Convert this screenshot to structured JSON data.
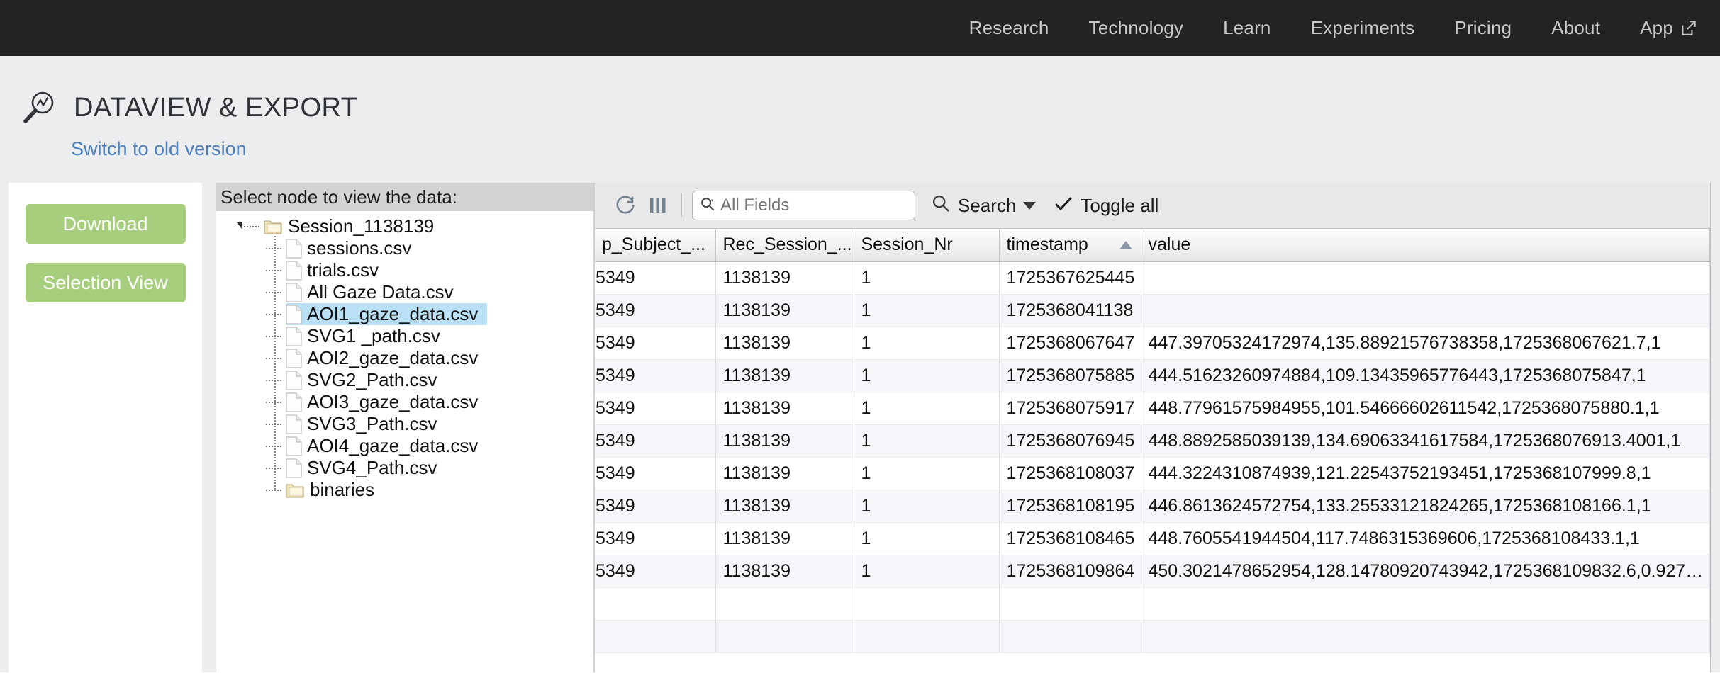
{
  "topnav": {
    "items": [
      {
        "label": "Research",
        "icon": null
      },
      {
        "label": "Technology",
        "icon": null
      },
      {
        "label": "Learn",
        "icon": null
      },
      {
        "label": "Experiments",
        "icon": null
      },
      {
        "label": "Pricing",
        "icon": null
      },
      {
        "label": "About",
        "icon": null
      },
      {
        "label": "App",
        "icon": "external-link-icon"
      }
    ],
    "background_color": "#232323",
    "text_color": "#c9c9c9"
  },
  "header": {
    "title": "DATAVIEW & EXPORT",
    "logo_icon": "magnifier-chart-icon",
    "switch_link": "Switch to old version",
    "link_color": "#4a7fbf",
    "band_color": "#ebedee"
  },
  "actions": {
    "download_label": "Download",
    "selection_view_label": "Selection View",
    "button_color": "#a6ce7c"
  },
  "tree": {
    "header": "Select node to view the data:",
    "root": {
      "label": "Session_1138139",
      "icon": "folder-icon"
    },
    "children": [
      {
        "label": "sessions.csv",
        "icon": "file-icon",
        "selected": false
      },
      {
        "label": "trials.csv",
        "icon": "file-icon",
        "selected": false
      },
      {
        "label": "All Gaze Data.csv",
        "icon": "file-icon",
        "selected": false
      },
      {
        "label": "AOI1_gaze_data.csv",
        "icon": "file-icon",
        "selected": true
      },
      {
        "label": "SVG1 _path.csv",
        "icon": "file-icon",
        "selected": false
      },
      {
        "label": "AOI2_gaze_data.csv",
        "icon": "file-icon",
        "selected": false
      },
      {
        "label": "SVG2_Path.csv",
        "icon": "file-icon",
        "selected": false
      },
      {
        "label": "AOI3_gaze_data.csv",
        "icon": "file-icon",
        "selected": false
      },
      {
        "label": "SVG3_Path.csv",
        "icon": "file-icon",
        "selected": false
      },
      {
        "label": "AOI4_gaze_data.csv",
        "icon": "file-icon",
        "selected": false
      },
      {
        "label": "SVG4_Path.csv",
        "icon": "file-icon",
        "selected": false
      },
      {
        "label": "binaries",
        "icon": "folder-icon",
        "selected": false
      }
    ],
    "selection_color": "#b9e0f5"
  },
  "toolbar": {
    "refresh_icon": "refresh-icon",
    "columns_icon": "columns-icon",
    "search_placeholder": "All Fields",
    "search_value": "",
    "search_field_icon": "search-field-icon",
    "search_label": "Search",
    "search_dropdown_icon": "chevron-down-icon",
    "toggle_all_label": "Toggle all",
    "toggle_all_icon": "check-icon"
  },
  "grid": {
    "columns": [
      {
        "label": "p_Subject_...",
        "sorted": false
      },
      {
        "label": "Rec_Session_...",
        "sorted": false
      },
      {
        "label": "Session_Nr",
        "sorted": false
      },
      {
        "label": "timestamp",
        "sorted": true,
        "sort_dir": "asc"
      },
      {
        "label": "value",
        "sorted": false
      }
    ],
    "rows": [
      {
        "subject": "5349",
        "rec_session": "1138139",
        "session_nr": "1",
        "timestamp": "1725367625445",
        "value": ""
      },
      {
        "subject": "5349",
        "rec_session": "1138139",
        "session_nr": "1",
        "timestamp": "1725368041138",
        "value": ""
      },
      {
        "subject": "5349",
        "rec_session": "1138139",
        "session_nr": "1",
        "timestamp": "1725368067647",
        "value": "447.39705324172974,135.88921576738358,1725368067621.7,1"
      },
      {
        "subject": "5349",
        "rec_session": "1138139",
        "session_nr": "1",
        "timestamp": "1725368075885",
        "value": "444.51623260974884,109.13435965776443,1725368075847,1"
      },
      {
        "subject": "5349",
        "rec_session": "1138139",
        "session_nr": "1",
        "timestamp": "1725368075917",
        "value": "448.77961575984955,101.54666602611542,1725368075880.1,1"
      },
      {
        "subject": "5349",
        "rec_session": "1138139",
        "session_nr": "1",
        "timestamp": "1725368076945",
        "value": "448.8892585039139,134.69063341617584,1725368076913.4001,1"
      },
      {
        "subject": "5349",
        "rec_session": "1138139",
        "session_nr": "1",
        "timestamp": "1725368108037",
        "value": "444.3224310874939,121.22543752193451,1725368107999.8,1"
      },
      {
        "subject": "5349",
        "rec_session": "1138139",
        "session_nr": "1",
        "timestamp": "1725368108195",
        "value": "446.8613624572754,133.25533121824265,1725368108166.1,1"
      },
      {
        "subject": "5349",
        "rec_session": "1138139",
        "session_nr": "1",
        "timestamp": "1725368108465",
        "value": "448.7605541944504,117.7486315369606,1725368108433.1,1"
      },
      {
        "subject": "5349",
        "rec_session": "1138139",
        "session_nr": "1",
        "timestamp": "1725368109864",
        "value": "450.3021478652954,128.14780920743942,1725368109832.6,0.927…"
      }
    ],
    "empty_rows": 2
  }
}
